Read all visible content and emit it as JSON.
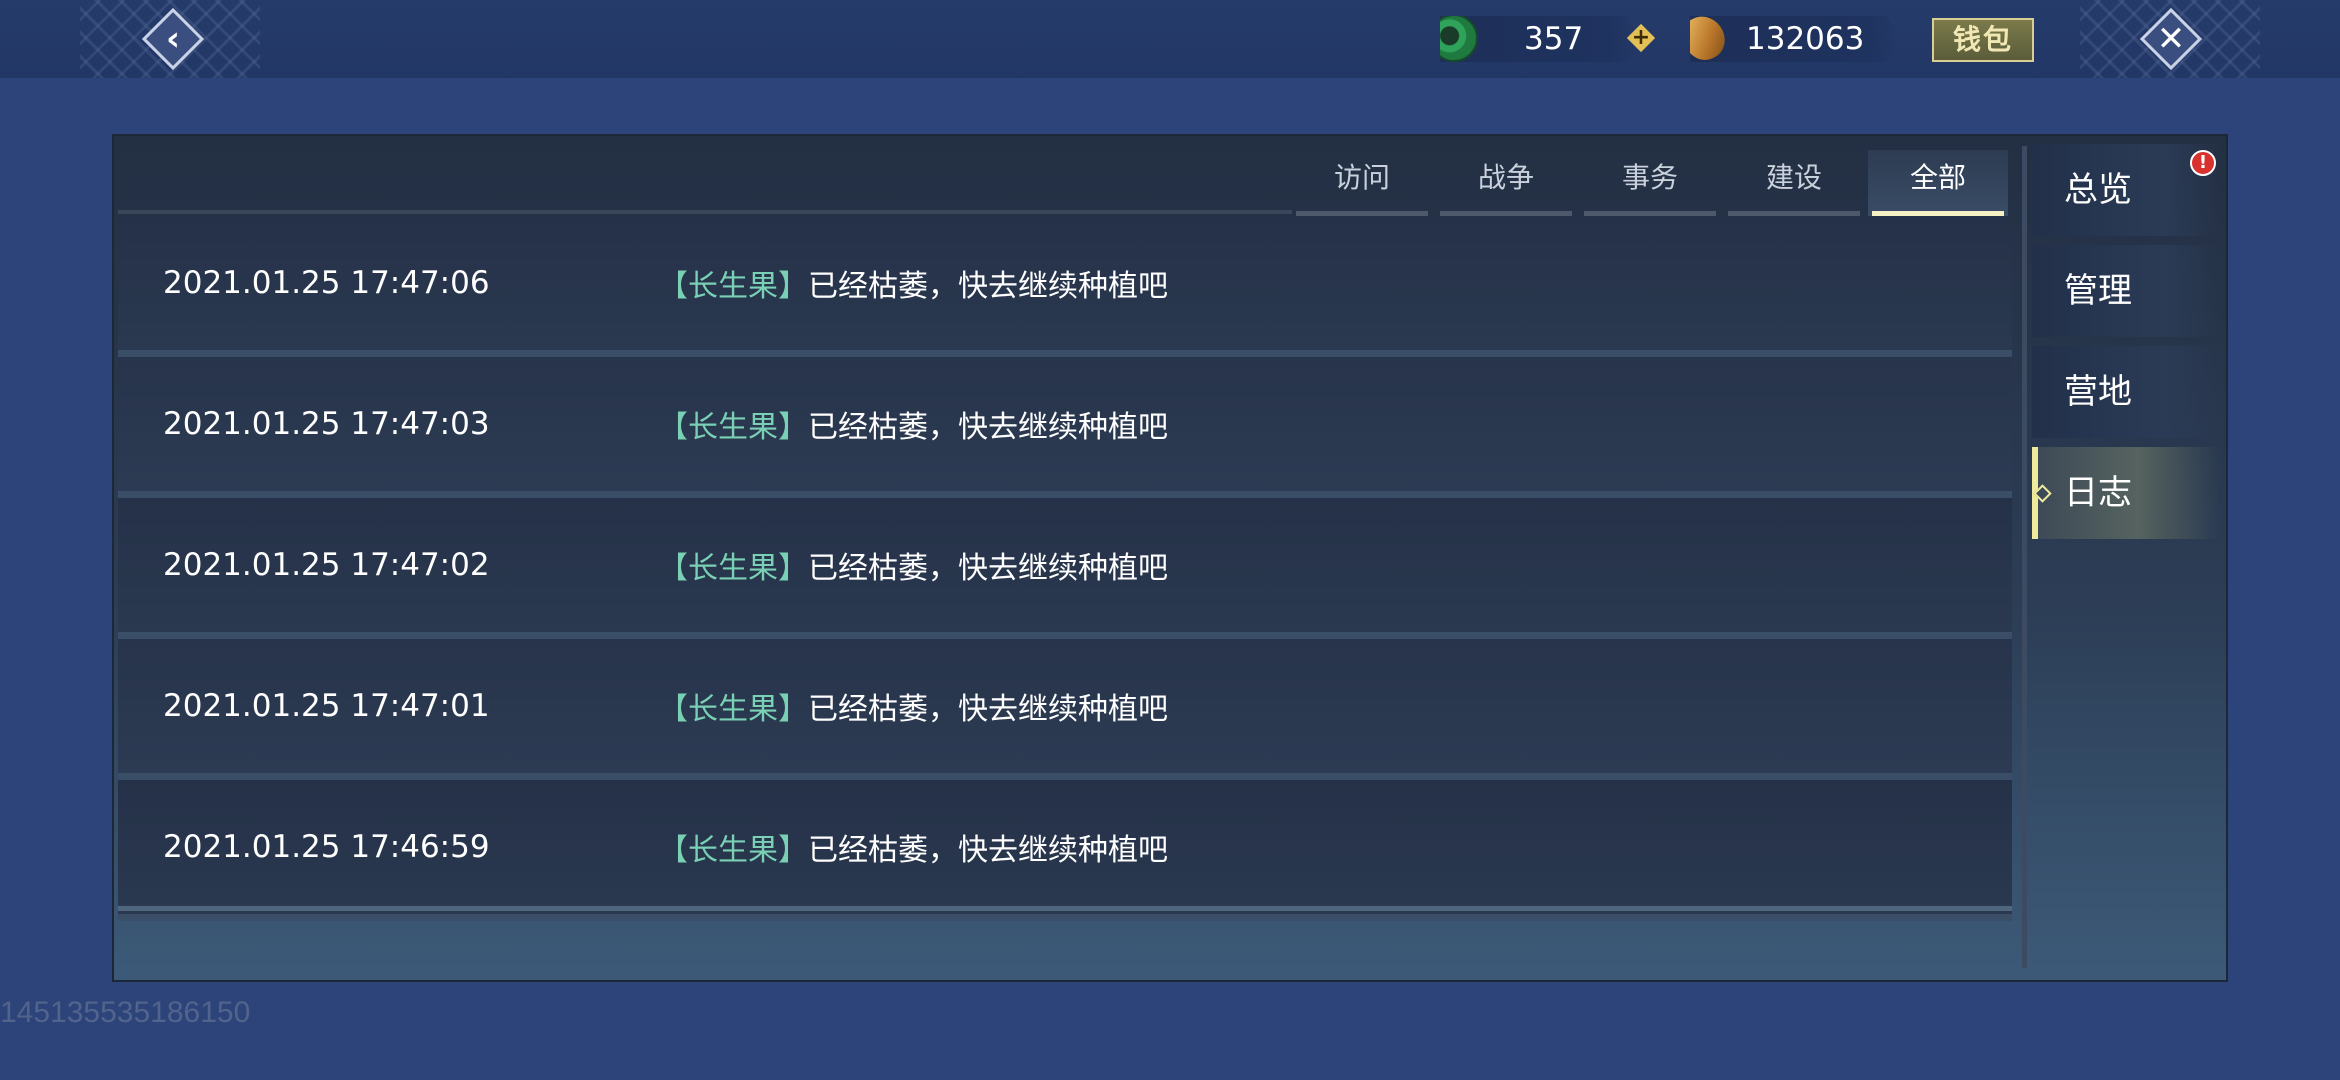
{
  "top_bar": {
    "back_icon": "back-arrow-icon",
    "close_icon": "close-x-icon",
    "jade": {
      "icon": "jade-icon",
      "value": "357"
    },
    "add_icon": "plus-icon",
    "coin": {
      "icon": "copper-coin-icon",
      "value": "132063"
    },
    "wallet_label": "钱包"
  },
  "tabs": [
    {
      "label": "访问",
      "active": false
    },
    {
      "label": "战争",
      "active": false
    },
    {
      "label": "事务",
      "active": false
    },
    {
      "label": "建设",
      "active": false
    },
    {
      "label": "全部",
      "active": true
    }
  ],
  "log_rows": [
    {
      "time": "2021.01.25 17:47:06",
      "bracket_open": "【",
      "item": "长生果",
      "bracket_close": "】",
      "message": "已经枯萎，快去继续种植吧"
    },
    {
      "time": "2021.01.25 17:47:03",
      "bracket_open": "【",
      "item": "长生果",
      "bracket_close": "】",
      "message": "已经枯萎，快去继续种植吧"
    },
    {
      "time": "2021.01.25 17:47:02",
      "bracket_open": "【",
      "item": "长生果",
      "bracket_close": "】",
      "message": "已经枯萎，快去继续种植吧"
    },
    {
      "time": "2021.01.25 17:47:01",
      "bracket_open": "【",
      "item": "长生果",
      "bracket_close": "】",
      "message": "已经枯萎，快去继续种植吧"
    },
    {
      "time": "2021.01.25 17:46:59",
      "bracket_open": "【",
      "item": "长生果",
      "bracket_close": "】",
      "message": "已经枯萎，快去继续种植吧"
    }
  ],
  "side_nav": [
    {
      "label": "总览",
      "active": false
    },
    {
      "label": "管理",
      "active": false
    },
    {
      "label": "营地",
      "active": false
    },
    {
      "label": "日志",
      "active": true
    }
  ],
  "alert_badge": "!",
  "footer_id": "145135535186150",
  "colors": {
    "background": "#2c4479",
    "panel": "#232f43",
    "active_accent": "#f0ea9c",
    "item_highlight": "#79d0b4",
    "alert": "#d8312e"
  }
}
